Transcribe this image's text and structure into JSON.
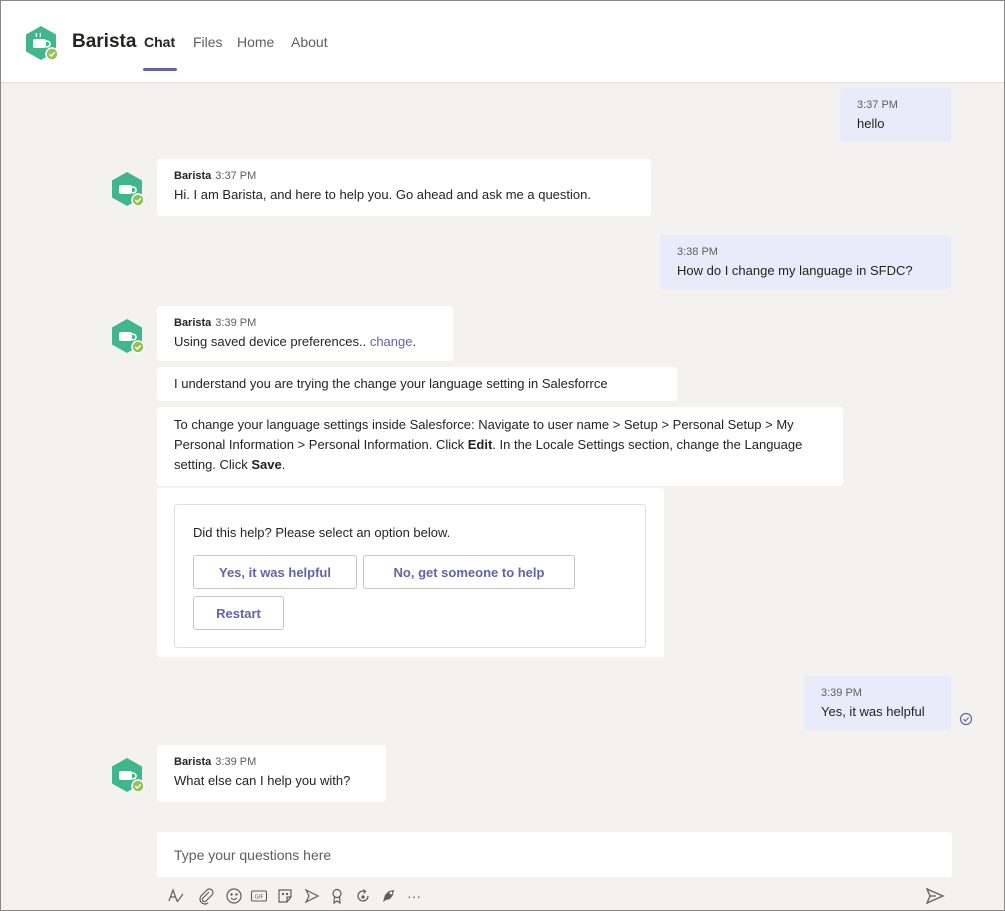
{
  "app": {
    "name": "Barista"
  },
  "tabs": [
    {
      "label": "Chat",
      "active": true
    },
    {
      "label": "Files",
      "active": false
    },
    {
      "label": "Home",
      "active": false
    },
    {
      "label": "About",
      "active": false
    }
  ],
  "messages": {
    "m1": {
      "time": "3:37 PM",
      "text": "hello"
    },
    "m2": {
      "sender": "Barista",
      "time": "3:37 PM",
      "text": "Hi. I am Barista, and here to help you. Go ahead and ask me a question."
    },
    "m3": {
      "time": "3:38 PM",
      "text": "How do I change my language in SFDC?"
    },
    "m4": {
      "sender": "Barista",
      "time": "3:39 PM",
      "text": "Using saved device preferences.. ",
      "link": "change",
      "after_link": "."
    },
    "m5": {
      "text": "I understand you are trying the change your language setting in Salesforrce"
    },
    "m6": {
      "part1": "To change your language settings inside Salesforce: Navigate to user name > Setup > Personal Setup > My Personal Information > Personal Information. Click ",
      "bold1": "Edit",
      "part2": ". In the Locale Settings section, change the Language setting. Click ",
      "bold2": "Save",
      "part3": "."
    },
    "card": {
      "question": "Did this help? Please select an option below.",
      "buttons": [
        "Yes, it was helpful",
        "No, get someone to help",
        "Restart"
      ]
    },
    "m7": {
      "time": "3:39 PM",
      "text": "Yes, it was helpful"
    },
    "m8": {
      "sender": "Barista",
      "time": "3:39 PM",
      "text": "What else can I help you with?"
    }
  },
  "compose": {
    "placeholder": "Type your questions here"
  },
  "toolbar": {
    "icons": [
      "format-icon",
      "attach-icon",
      "emoji-icon",
      "gif-icon",
      "sticker-icon",
      "meet-icon",
      "praise-icon",
      "loop-icon",
      "app-icon",
      "more-icon"
    ],
    "gif_label": "GIF",
    "more_label": "···"
  },
  "colors": {
    "accent": "#6264a7",
    "logo_green": "#3fb68b",
    "presence": "#92c353",
    "my_bubble": "#e8ebfa"
  }
}
